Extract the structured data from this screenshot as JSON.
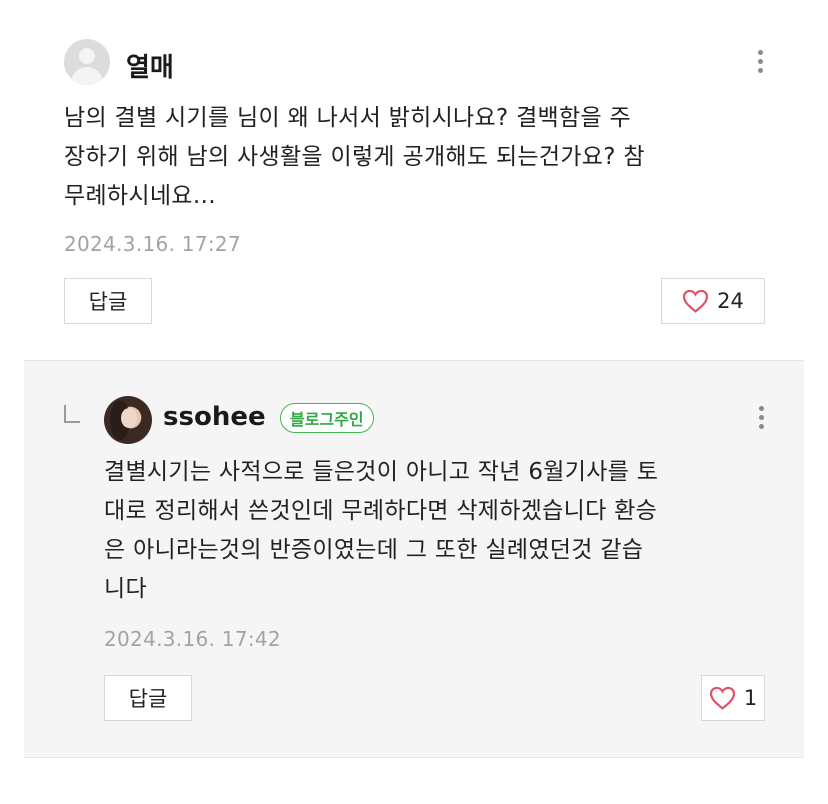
{
  "comment": {
    "username": "열매",
    "lines": [
      "남의 결별 시기를 님이 왜 나서서 밝히시나요? 결백함을 주",
      "장하기 위해 남의 사생활을 이렇게 공개해도 되는건가요? 참",
      "무례하시네요…"
    ],
    "date": "2024.3.16. 17:27",
    "reply_label": "답글",
    "likes": "24"
  },
  "reply": {
    "username": "ssohee",
    "badge": "블로그주인",
    "lines": [
      "결별시기는 사적으로 들은것이 아니고 작년 6월기사를 토",
      "대로 정리해서 쓴것인데 무례하다면 삭제하겠습니다 환승",
      "은 아니라는것의 반증이였는데 그 또한 실례였던것 같습",
      "니다"
    ],
    "date": "2024.3.16. 17:42",
    "reply_label": "답글",
    "likes": "1"
  },
  "icons": {
    "more": "more-vertical-icon",
    "heart": "heart-outline-icon",
    "reply_arrow": "reply-arrow-icon",
    "heart_color": "#e0506a",
    "badge_color": "#3fb654"
  }
}
